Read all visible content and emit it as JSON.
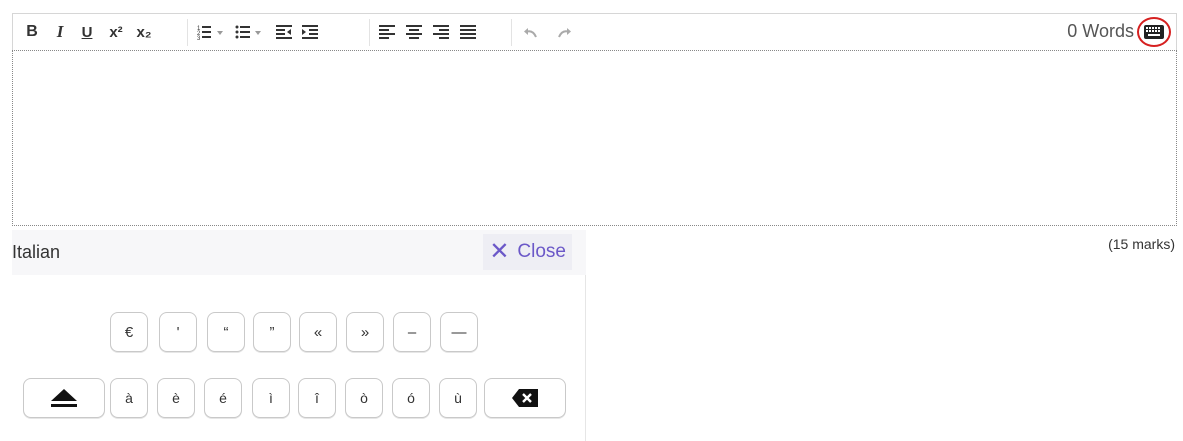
{
  "toolbar": {
    "word_count": "0 Words",
    "buttons": {
      "bold": "B",
      "italic": "I",
      "underline": "U",
      "superscript": "x²",
      "subscript": "x₂"
    }
  },
  "editor": {
    "content": ""
  },
  "keyboard": {
    "language": "Italian",
    "close_label": "Close",
    "row1": [
      "€",
      "'",
      "“",
      "”",
      "«",
      "»",
      "–",
      "—"
    ],
    "row2": [
      "à",
      "è",
      "é",
      "ì",
      "î",
      "ò",
      "ó",
      "ù"
    ]
  },
  "marks": "(15 marks)"
}
